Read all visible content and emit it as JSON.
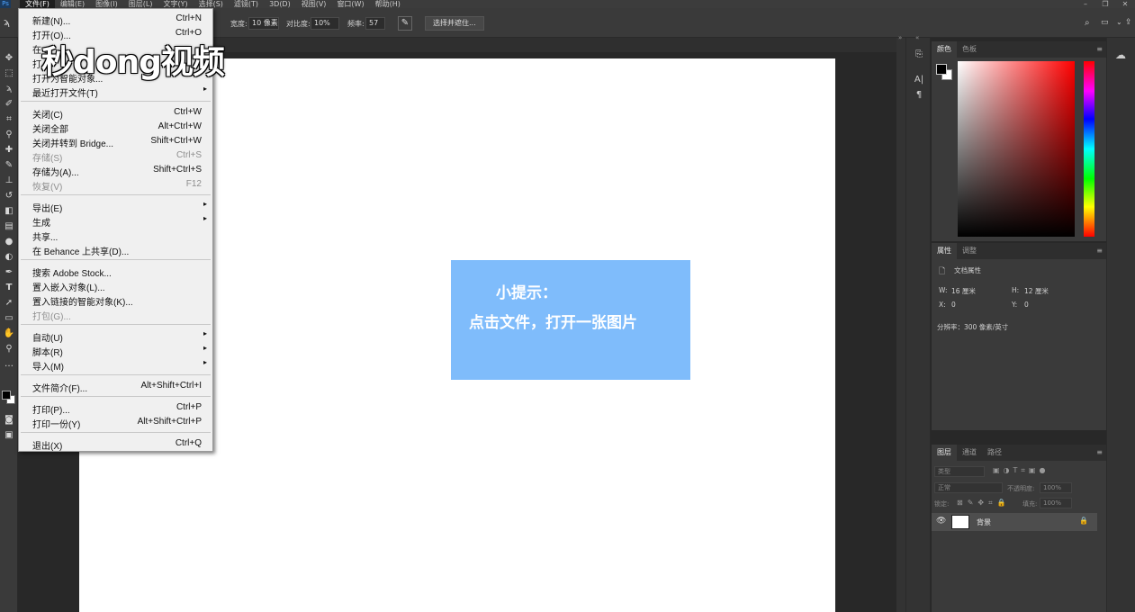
{
  "menubar": {
    "items": [
      "文件(F)",
      "编辑(E)",
      "图像(I)",
      "图层(L)",
      "文字(Y)",
      "选择(S)",
      "滤镜(T)",
      "3D(D)",
      "视图(V)",
      "窗口(W)",
      "帮助(H)"
    ]
  },
  "options": {
    "width_label": "宽度:",
    "width_value": "10 像素",
    "contrast_label": "对比度:",
    "contrast_value": "10%",
    "frequency_label": "频率:",
    "frequency_value": "57",
    "select_mask_button": "选择并遮住..."
  },
  "file_menu": {
    "items": [
      {
        "label": "新建(N)...",
        "shortcut": "Ctrl+N"
      },
      {
        "label": "打开(O)...",
        "shortcut": "Ctrl+O"
      },
      {
        "label": "在 B",
        "shortcut": ""
      },
      {
        "label": "打",
        "shortcut": ""
      },
      {
        "label": "打开为智能对象...",
        "shortcut": ""
      },
      {
        "label": "最近打开文件(T)",
        "shortcut": ""
      },
      {
        "label": "关闭(C)",
        "shortcut": "Ctrl+W"
      },
      {
        "label": "关闭全部",
        "shortcut": "Alt+Ctrl+W"
      },
      {
        "label": "关闭并转到 Bridge...",
        "shortcut": "Shift+Ctrl+W"
      },
      {
        "label": "存储(S)",
        "shortcut": "Ctrl+S"
      },
      {
        "label": "存储为(A)...",
        "shortcut": "Shift+Ctrl+S"
      },
      {
        "label": "恢复(V)",
        "shortcut": "F12"
      },
      {
        "label": "导出(E)",
        "shortcut": ""
      },
      {
        "label": "生成",
        "shortcut": ""
      },
      {
        "label": "共享...",
        "shortcut": ""
      },
      {
        "label": "在 Behance 上共享(D)...",
        "shortcut": ""
      },
      {
        "label": "搜索 Adobe Stock...",
        "shortcut": ""
      },
      {
        "label": "置入嵌入对象(L)...",
        "shortcut": ""
      },
      {
        "label": "置入链接的智能对象(K)...",
        "shortcut": ""
      },
      {
        "label": "打包(G)...",
        "shortcut": ""
      },
      {
        "label": "自动(U)",
        "shortcut": ""
      },
      {
        "label": "脚本(R)",
        "shortcut": ""
      },
      {
        "label": "导入(M)",
        "shortcut": ""
      },
      {
        "label": "文件简介(F)...",
        "shortcut": "Alt+Shift+Ctrl+I"
      },
      {
        "label": "打印(P)...",
        "shortcut": "Ctrl+P"
      },
      {
        "label": "打印一份(Y)",
        "shortcut": "Alt+Shift+Ctrl+P"
      },
      {
        "label": "退出(X)",
        "shortcut": "Ctrl+Q"
      }
    ]
  },
  "watermark": {
    "text": "秒dong视频"
  },
  "tip": {
    "title": "小提示：",
    "body": "点击文件，打开一张图片"
  },
  "color_panel": {
    "tabs": [
      "颜色",
      "色板"
    ]
  },
  "properties_panel": {
    "tabs": [
      "属性",
      "调整"
    ],
    "doc_props": "文档属性",
    "w_label": "W:",
    "w_value": "16 厘米",
    "h_label": "H:",
    "h_value": "12 厘米",
    "x_label": "X:",
    "x_value": "0",
    "y_label": "Y:",
    "y_value": "0",
    "resolution": "分辨率：300 像素/英寸"
  },
  "layers_panel": {
    "tabs": [
      "图层",
      "通道",
      "路径"
    ],
    "kind_placeholder": "类型",
    "blend_mode": "正常",
    "opacity_label": "不透明度:",
    "opacity_value": "100%",
    "lock_label": "锁定:",
    "fill_label": "填充:",
    "fill_value": "100%",
    "layer_name": "背景"
  },
  "colors": {
    "tip_bg": "#7fbcfb",
    "ui_dark": "#3a3a3a",
    "canvas_bg": "#282828"
  }
}
